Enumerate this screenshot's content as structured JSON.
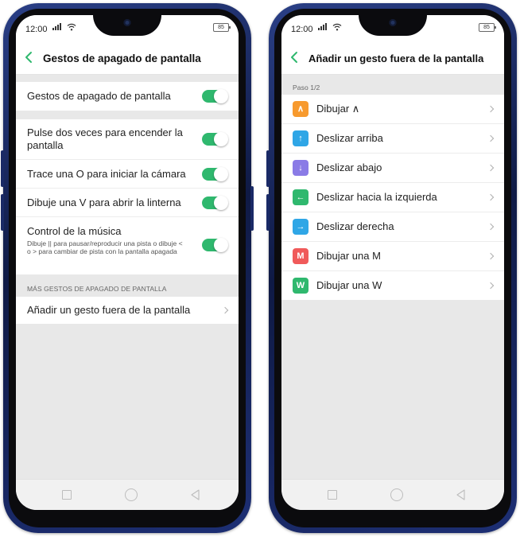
{
  "left_screen": {
    "status_bar": {
      "time": "12:00",
      "battery": "85"
    },
    "header": {
      "title": "Gestos de apagado de pantalla"
    },
    "master_toggle": {
      "label": "Gestos de apagado de pantalla",
      "on": true
    },
    "gesture_toggles": [
      {
        "label": "Pulse dos veces para encender la pantalla",
        "on": true
      },
      {
        "label": "Trace una O para iniciar la cámara",
        "on": true
      },
      {
        "label": "Dibuje una V para abrir la linterna",
        "on": true
      },
      {
        "label": "Control de la música",
        "description": "Dibuje || para pausar/reproducir una pista o dibuje < o > para cambiar de pista con la pantalla apagada",
        "on": true
      }
    ],
    "section_title": "MÁS GESTOS DE APAGADO DE PANTALLA",
    "add_gesture": {
      "label": "Añadir un gesto fuera de la pantalla"
    }
  },
  "right_screen": {
    "status_bar": {
      "time": "12:00",
      "battery": "85"
    },
    "header": {
      "title": "Añadir un gesto fuera de la pantalla"
    },
    "step_label": "Paso 1/2",
    "gestures": [
      {
        "label": "Dibujar ∧",
        "glyph": "∧",
        "color": "#f79a2e",
        "icon": "caret-up-icon"
      },
      {
        "label": "Deslizar arriba",
        "glyph": "↑",
        "color": "#2fa6e6",
        "icon": "arrow-up-icon"
      },
      {
        "label": "Deslizar abajo",
        "glyph": "↓",
        "color": "#8a7be6",
        "icon": "arrow-down-icon"
      },
      {
        "label": "Deslizar hacia la izquierda",
        "glyph": "←",
        "color": "#2fb86e",
        "icon": "arrow-left-icon"
      },
      {
        "label": "Deslizar derecha",
        "glyph": "→",
        "color": "#2fa6e6",
        "icon": "arrow-right-icon"
      },
      {
        "label": "Dibujar una M",
        "glyph": "M",
        "color": "#f05a5a",
        "icon": "letter-m-icon"
      },
      {
        "label": "Dibujar una W",
        "glyph": "W",
        "color": "#2fb86e",
        "icon": "letter-w-icon"
      }
    ]
  }
}
